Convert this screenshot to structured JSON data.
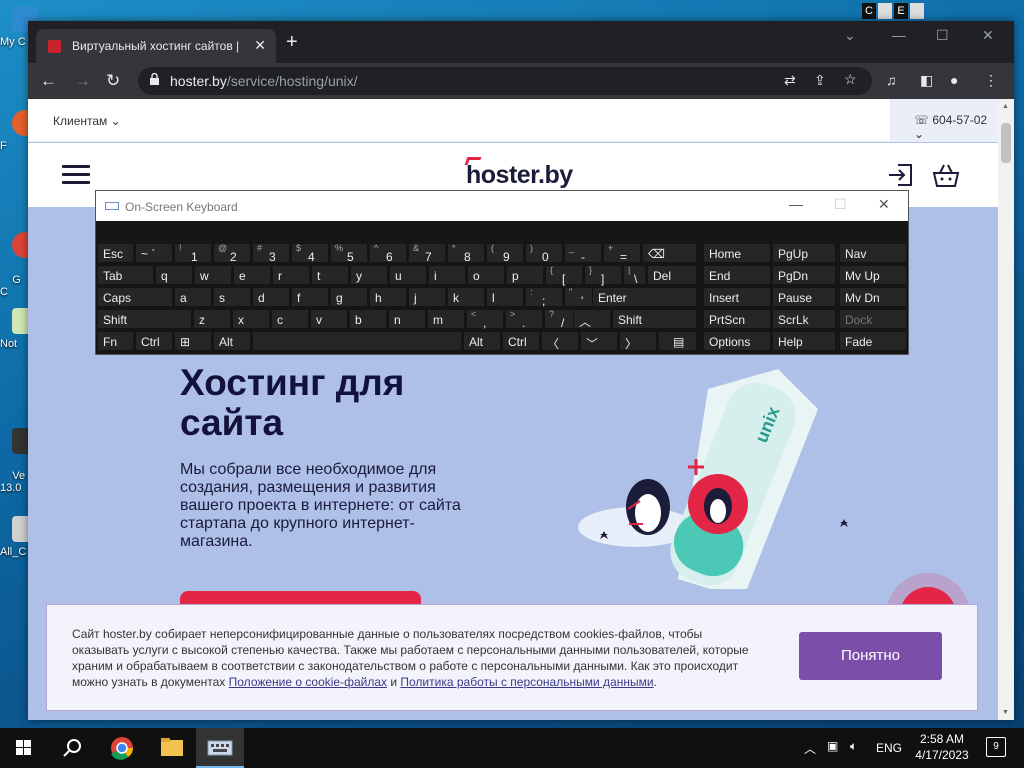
{
  "desktop": {
    "icons": [
      {
        "label": "My C"
      },
      {
        "label": "F"
      },
      {
        "label": "G\nC"
      },
      {
        "label": "Not"
      },
      {
        "label": "Ve\n13.0"
      },
      {
        "label": "All_C"
      }
    ],
    "top_corner": [
      "C",
      "E"
    ]
  },
  "browser": {
    "tab_title": "Виртуальный хостинг сайтов | Х",
    "url_host": "hoster.by",
    "url_path": "/service/hosting/unix/"
  },
  "page": {
    "clients": "Клиентам",
    "phone": "604-57-02",
    "logo": "hoster.by",
    "hero_title_lines": [
      "Хостинг для",
      "сайта"
    ],
    "hero_desc": "Мы собрали все необходимое для создания, размещения и развития вашего проекта в интернете: от сайта стартапа до крупного интернет-магазина.",
    "illus_label": "unix",
    "cookie": {
      "text": "Сайт hoster.by собирает неперсонифицированные данные о пользователях посредством cookies-файлов, чтобы оказывать услуги с высокой степенью качества. Также мы работаем с персональными данными пользователей, которые храним и обрабатываем в соответствии с законодательством о работе с персональными данными. Как это происходит можно узнать в документах ",
      "link1": "Положение о cookie-файлах",
      "and": " и ",
      "link2": "Политика работы с персональными данными",
      "end": ".",
      "button": "Понятно"
    }
  },
  "osk": {
    "title": "On-Screen Keyboard",
    "keys": {
      "esc": "Esc",
      "tab": "Tab",
      "caps": "Caps",
      "shift_l": "Shift",
      "fn": "Fn",
      "ctrl_l": "Ctrl",
      "alt_l": "Alt",
      "n1": "1",
      "n2": "2",
      "n3": "3",
      "n4": "4",
      "n5": "5",
      "n6": "6",
      "n7": "7",
      "n8": "8",
      "n9": "9",
      "n0": "0",
      "s1": "!",
      "s2": "@",
      "s3": "#",
      "s4": "$",
      "s5": "%",
      "s6": "^",
      "s7": "&",
      "s8": "*",
      "s9": "(",
      "s0": ")",
      "grave": "`",
      "tilde": "~",
      "minus": "-",
      "under": "_",
      "eq": "=",
      "plus": "+",
      "q": "q",
      "w": "w",
      "e": "e",
      "r": "r",
      "t": "t",
      "y": "y",
      "u": "u",
      "i": "i",
      "o": "o",
      "p": "p",
      "lbr": "[",
      "lbr_s": "{",
      "rbr": "]",
      "rbr_s": "}",
      "bsl": "\\",
      "bsl_s": "|",
      "del": "Del",
      "a": "a",
      "s": "s",
      "d": "d",
      "f": "f",
      "g": "g",
      "h": "h",
      "j": "j",
      "k": "k",
      "l": "l",
      "semi": ";",
      "colon": ":",
      "quote": "'",
      "dquote": "\"",
      "enter": "Enter",
      "z": "z",
      "x": "x",
      "c": "c",
      "v": "v",
      "b": "b",
      "n": "n",
      "m": "m",
      "comma": ",",
      "lt": "<",
      "dot": ".",
      "gt": ">",
      "slash": "/",
      "qmark": "?",
      "shift_r": "Shift",
      "alt_r": "Alt",
      "ctrl_r": "Ctrl",
      "home": "Home",
      "pgup": "PgUp",
      "nav": "Nav",
      "end": "End",
      "pgdn": "PgDn",
      "mvup": "Mv Up",
      "insert": "Insert",
      "pause": "Pause",
      "mvdn": "Mv Dn",
      "prtscn": "PrtScn",
      "scrlk": "ScrLk",
      "dock": "Dock",
      "options": "Options",
      "help": "Help",
      "fade": "Fade"
    }
  },
  "taskbar": {
    "lang": "ENG",
    "time": "2:58 AM",
    "date": "4/17/2023",
    "notifications": "9"
  },
  "colors": {
    "brand_red": "#e32546",
    "accept_purple": "#7b4ea9",
    "hero_bg": "#aebfe8"
  }
}
